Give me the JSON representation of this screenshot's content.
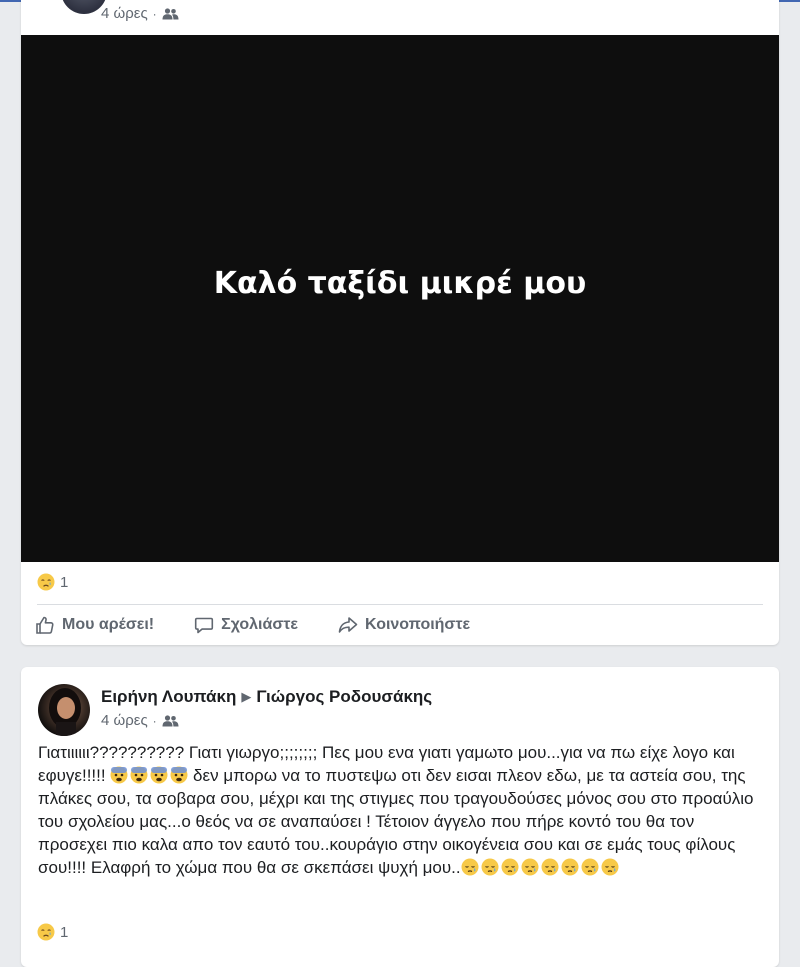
{
  "post1": {
    "time": "4 ώρες",
    "separator": "·",
    "audience_icon": "friends-icon",
    "image_text": "Καλό ταξίδι μικρέ μου",
    "reaction_icon": "crying-face-icon",
    "reaction_count": "1",
    "actions": {
      "like": "Μου αρέσει!",
      "comment": "Σχολιάστε",
      "share": "Κοινοποιήστε"
    }
  },
  "post2": {
    "author": "Ειρήνη Λουπάκη",
    "arrow": "▶",
    "recipient": "Γιώργος Ροδουσάκης",
    "time": "4 ώρες",
    "separator": "·",
    "audience_icon": "friends-icon",
    "text_part1": "Γιατιιιιιι?????????? Γιατι γιωργο;;;;;;;; Πες μου ενα γιατι γαμωτο μου...για να πω είχε λογο και εφυγε!!!!! ",
    "text_part2": " δεν μπορω να το πυστεψω οτι δεν εισαι πλεον εδω, με τα αστεία σου, της πλάκες σου, τα σοβαρα σου, μέχρι και της στιγμες που τραγουδούσες μόνος σου στο προαύλιο του σχολείου μας...ο θεός να σε αναπαύσει ! Τέτοιον άγγελο που πήρε κοντό του θα τον προσεχει πιο καλα απο τον εαυτό του..κουράγιο στην οικογένεια σου και σε εμάς τους φίλους σου!!!! Ελαφρή το χώμα που θα σε σκεπάσει ψυχή μου..",
    "fearful_emoji_count": 4,
    "sleepy_emoji_count": 8,
    "reaction_icon": "crying-face-icon",
    "reaction_count": "1"
  },
  "colors": {
    "background": "#e9ebee",
    "card": "#ffffff",
    "secondary_text": "#606770",
    "media_background": "#0e0e0e",
    "emoji_yellow": "#f7c948"
  }
}
